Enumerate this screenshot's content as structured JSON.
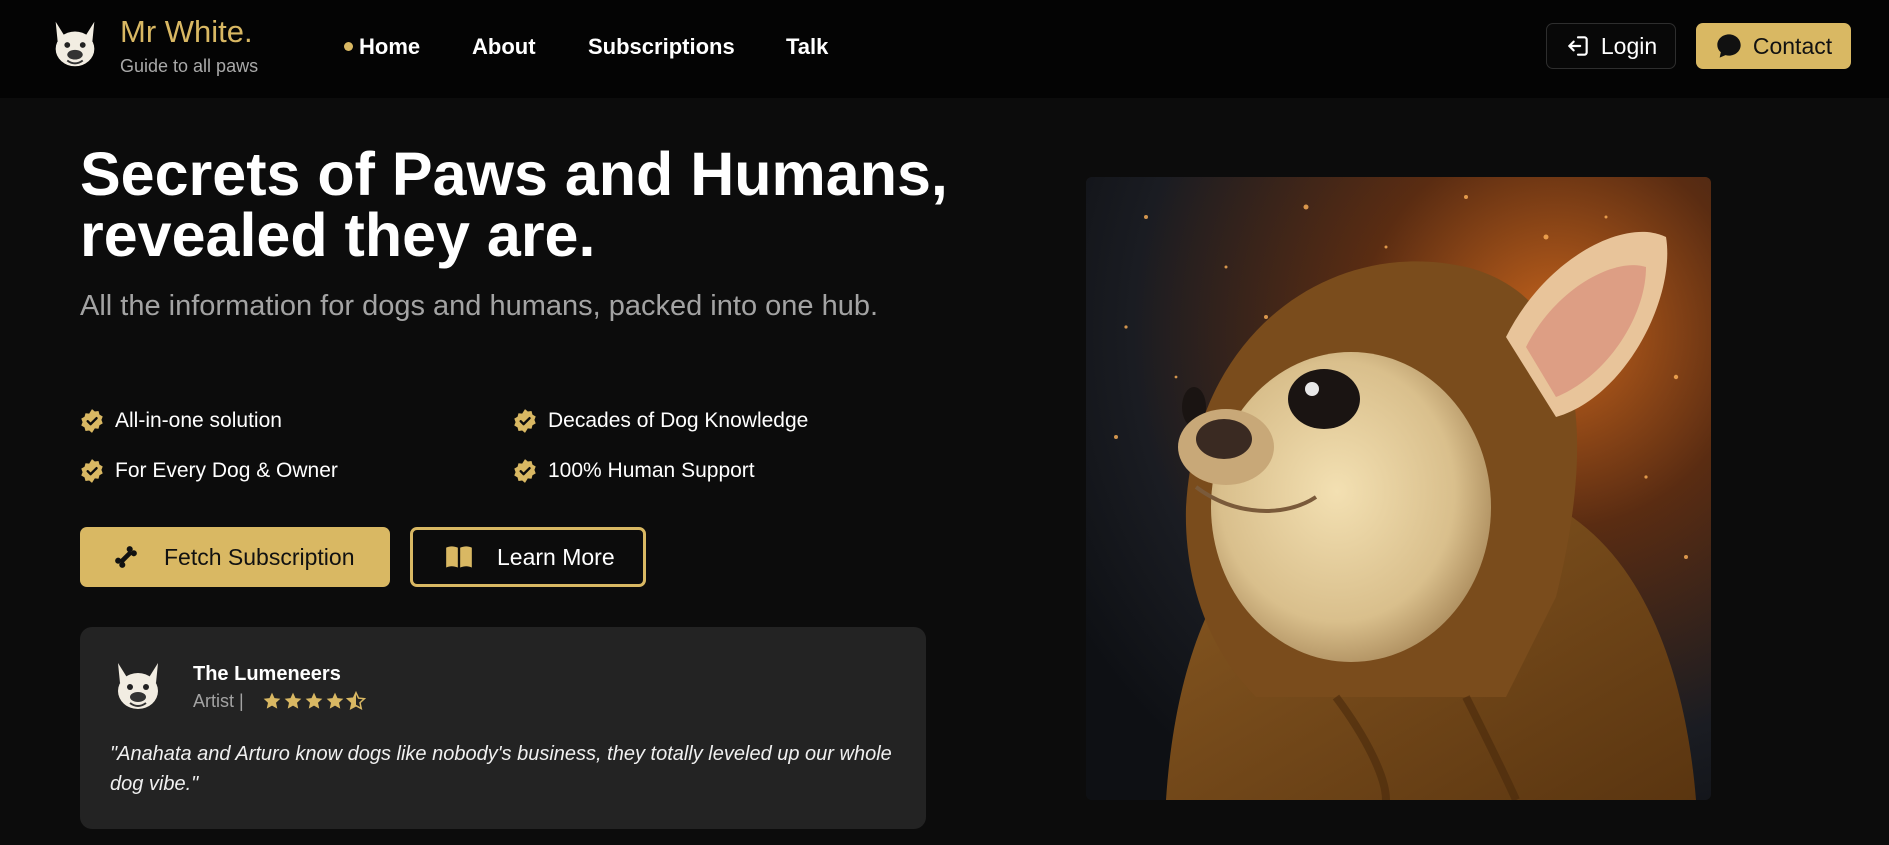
{
  "brand": {
    "name": "Mr White.",
    "tagline": "Guide to all paws",
    "accent_color": "#d9b863"
  },
  "nav": {
    "items": [
      {
        "label": "Home",
        "active": true
      },
      {
        "label": "About",
        "active": false
      },
      {
        "label": "Subscriptions",
        "active": false
      },
      {
        "label": "Talk",
        "active": false
      }
    ]
  },
  "header_actions": {
    "login_label": "Login",
    "login_icon": "login-arrow-icon",
    "contact_label": "Contact",
    "contact_icon": "chat-bubble-icon"
  },
  "hero": {
    "title": "Secrets of Paws and Humans, revealed they are.",
    "subtitle": "All the information for dogs and humans, packed into one hub.",
    "features": [
      {
        "label": "All-in-one solution",
        "icon": "check-badge-icon"
      },
      {
        "label": "Decades of Dog Knowledge",
        "icon": "check-badge-icon"
      },
      {
        "label": "For Every Dog & Owner",
        "icon": "check-badge-icon"
      },
      {
        "label": "100% Human Support",
        "icon": "check-badge-icon"
      }
    ],
    "primary_button": {
      "label": "Fetch Subscription",
      "icon": "bone-icon"
    },
    "secondary_button": {
      "label": "Learn More",
      "icon": "book-icon"
    }
  },
  "testimonial": {
    "name": "The Lumeneers",
    "role": "Artist |",
    "rating": 4.5,
    "rating_max": 5,
    "quote": "\"Anahata and Arturo know dogs like nobody's business, they totally leveled up our whole dog vibe.\""
  },
  "hero_image": {
    "subject": "dog-in-hooded-robe-image"
  }
}
